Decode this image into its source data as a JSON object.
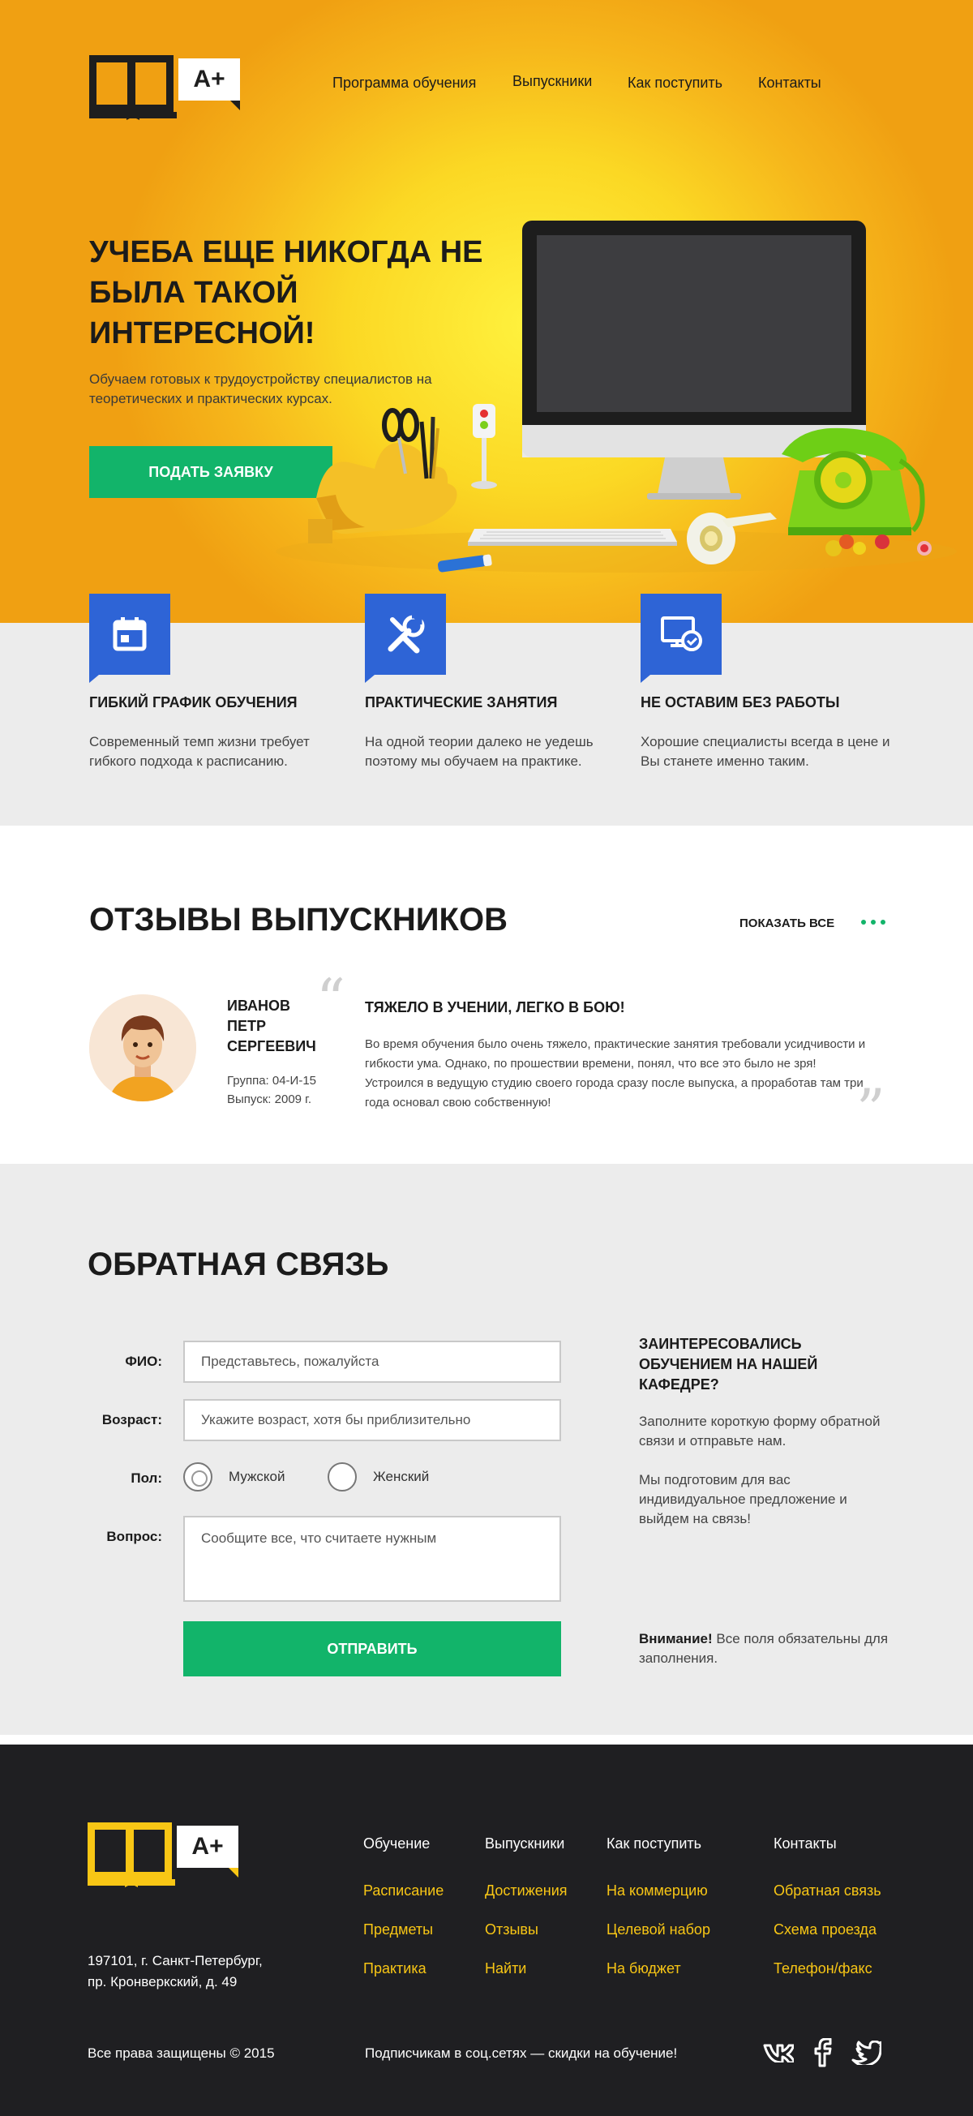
{
  "brand": {
    "grade": "A+"
  },
  "nav": [
    "Программа обучения",
    "Выпускники",
    "Как поступить",
    "Контакты"
  ],
  "hero": {
    "title": "Учеба еще никогда не была такой интересной!",
    "subtitle": "Обучаем готовых к трудоустройству специалистов на теоретических и практических курсах.",
    "button": "Подать заявку"
  },
  "features": [
    {
      "icon": "calendar-icon",
      "title": "Гибкий график обучения",
      "text": "Современный темп жизни требует гибкого подхода к расписанию."
    },
    {
      "icon": "tools-icon",
      "title": "Практические занятия",
      "text": "На одной теории далеко не уедешь поэтому мы обучаем на практике."
    },
    {
      "icon": "monitor-check-icon",
      "title": "Не оставим без работы",
      "text": "Хорошие специалисты всегда в цене и Вы станете именно таким."
    }
  ],
  "reviews": {
    "heading": "Отзывы выпускников",
    "show_all": "Показать все",
    "item": {
      "name": "Иванов Петр Сергеевич",
      "group": "Группа: 04-И-15",
      "year": "Выпуск: 2009 г.",
      "title": "Тяжело в учении, легко в бою!",
      "text": "Во время обучения было очень тяжело, практические занятия требовали усидчивости и гибкости ума. Однако, по прошествии времени, понял, что все это было не зря! Устроился в ведущую студию своего города сразу после выпуска, а проработав там три года основал свою собственную!"
    }
  },
  "feedback": {
    "heading": "Обратная связь",
    "fio_label": "ФИО:",
    "fio_placeholder": "Представьтесь, пожалуйста",
    "age_label": "Возраст:",
    "age_placeholder": "Укажите возраст, хотя бы приблизительно",
    "gender_label": "Пол:",
    "gender_male": "Мужской",
    "gender_female": "Женский",
    "question_label": "Вопрос:",
    "question_placeholder": "Сообщите все, что считаете нужным",
    "submit": "Отправить",
    "side_title": "Заинтересовались обучением на нашей кафедре?",
    "side_text1": "Заполните короткую форму обратной связи и отправьте нам.",
    "side_text2": "Мы подготовим для вас индивидуальное предложение и выйдем на связь!",
    "note_bold": "Внимание!",
    "note_text": " Все поля обязательны для заполнения."
  },
  "footer": {
    "columns": [
      {
        "head": "Обучение",
        "links": [
          "Расписание",
          "Предметы",
          "Практика"
        ]
      },
      {
        "head": "Выпускники",
        "links": [
          "Достижения",
          "Отзывы",
          "Найти"
        ]
      },
      {
        "head": "Как поступить",
        "links": [
          "На коммерцию",
          "Целевой набор",
          "На бюджет"
        ]
      },
      {
        "head": "Контакты",
        "links": [
          "Обратная связь",
          "Схема проезда",
          "Телефон/факс"
        ]
      }
    ],
    "address_line1": "197101, г. Санкт-Петербург,",
    "address_line2": "пр. Кронверкский, д. 49",
    "copyright": "Все права защищены © 2015",
    "subscribe": "Подписчикам в соц.сетях — скидки на обучение!",
    "social": [
      "vk-icon",
      "facebook-icon",
      "twitter-icon"
    ]
  },
  "colors": {
    "accent_green": "#12b46a",
    "feature_blue": "#2e64d6",
    "footer_yellow": "#f8c615",
    "footer_bg": "#1f1f22"
  }
}
